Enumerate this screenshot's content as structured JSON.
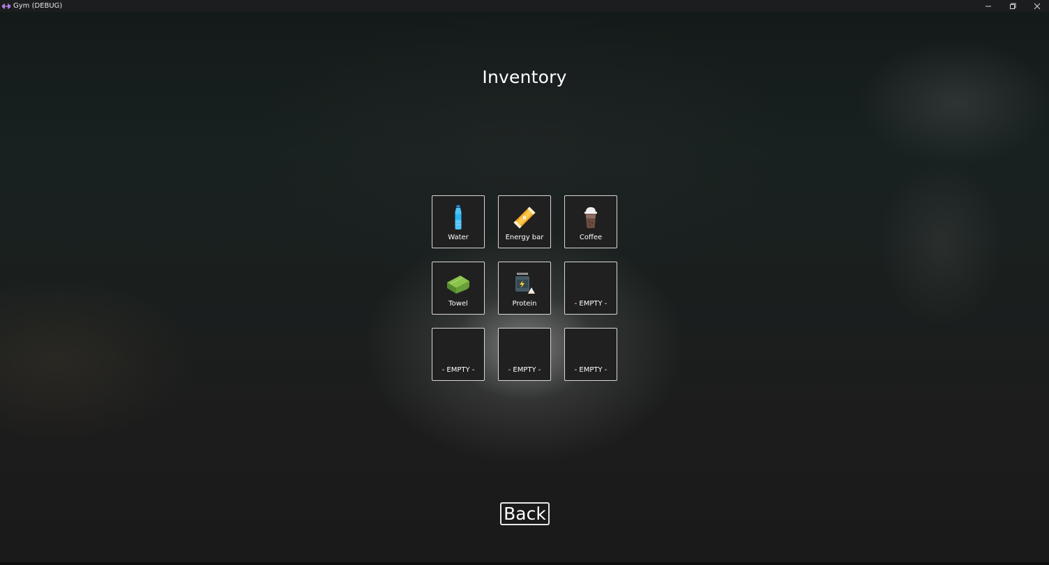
{
  "window": {
    "title": "Gym (DEBUG)",
    "controls": [
      "minimize-icon",
      "restore-icon",
      "close-icon"
    ]
  },
  "screen": {
    "title": "Inventory",
    "back_label": "Back"
  },
  "inventory": {
    "slots": [
      {
        "label": "Water",
        "icon": "water-bottle-icon"
      },
      {
        "label": "Energy bar",
        "icon": "energy-bar-icon"
      },
      {
        "label": "Coffee",
        "icon": "coffee-cup-icon"
      },
      {
        "label": "Towel",
        "icon": "towel-icon"
      },
      {
        "label": "Protein",
        "icon": "protein-tub-icon"
      },
      {
        "label": "- EMPTY -",
        "icon": null
      },
      {
        "label": "- EMPTY -",
        "icon": null
      },
      {
        "label": "- EMPTY -",
        "icon": null
      },
      {
        "label": "- EMPTY -",
        "icon": null
      }
    ]
  },
  "colors": {
    "slot_border": "#d9d9d9",
    "slot_background": "#202021",
    "title_color": "#ffffff"
  }
}
